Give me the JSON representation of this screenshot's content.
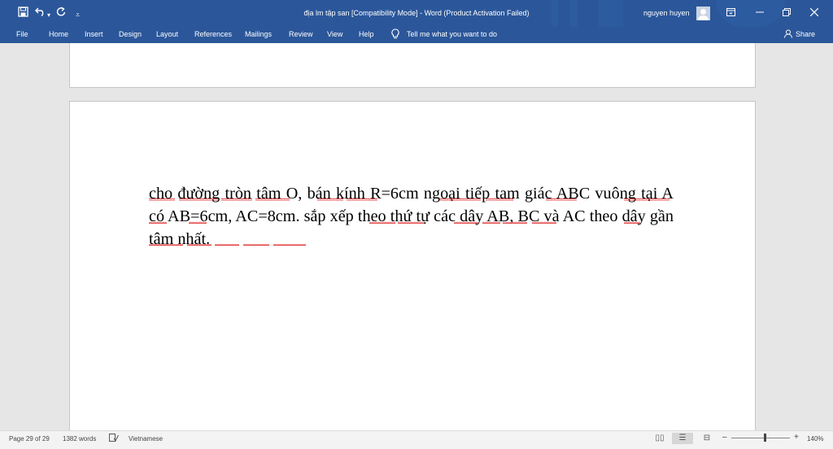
{
  "titlebar": {
    "save_icon": "save-icon",
    "undo_icon": "undo-icon",
    "redo_icon": "redo-icon",
    "customize_icon": "customize-quick-access-icon",
    "title": "địa lm tập san [Compatibility Mode]  -  Word (Product Activation Failed)",
    "user": "nguyen huyen",
    "ribbon_display_icon": "ribbon-display-options-icon",
    "minimize_icon": "minimize-icon",
    "restore_icon": "restore-icon",
    "close_icon": "close-icon",
    "colors": {
      "brand": "#2b579a"
    }
  },
  "ribbon": {
    "tabs": [
      "File",
      "Home",
      "Insert",
      "Design",
      "Layout",
      "References",
      "Mailings",
      "Review",
      "View",
      "Help"
    ],
    "tell_me": "Tell me what you want to do",
    "share": "Share"
  },
  "document": {
    "body": "cho đường tròn tâm O, bán kính R=6cm ngoại tiếp tam giác ABC vuông tại A có AB=6cm, AC=8cm. sắp xếp theo thứ tự các dây AB, BC và AC theo dây gần tâm nhất."
  },
  "statusbar": {
    "page": "Page 29 of 29",
    "words": "1382 words",
    "language": "Vietnamese",
    "minus": "–",
    "plus": "+",
    "zoom": "140%",
    "zoom_fraction": 0.57
  }
}
